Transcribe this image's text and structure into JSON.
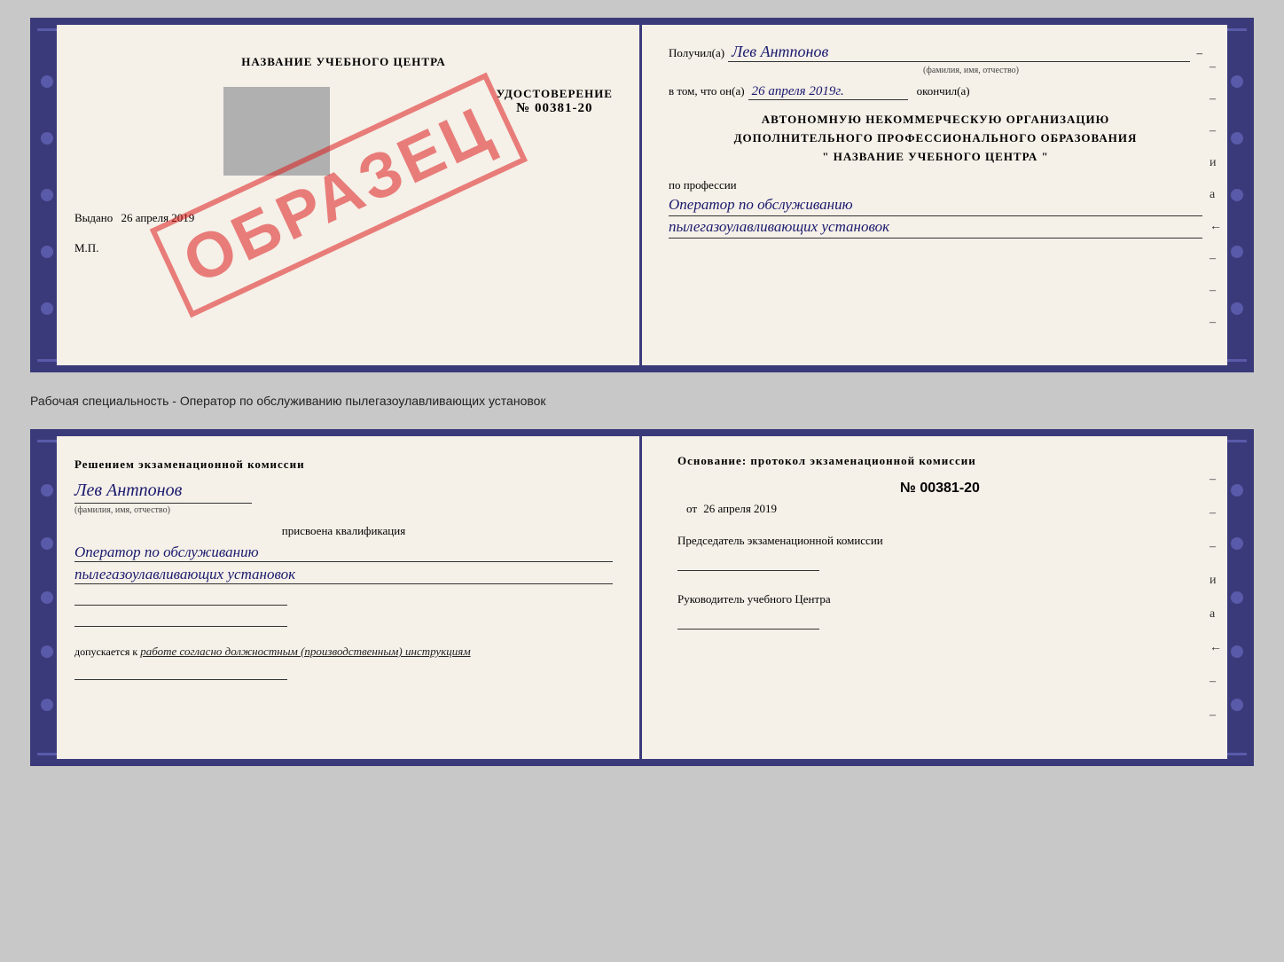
{
  "top_cert": {
    "left": {
      "title": "НАЗВАНИЕ УЧЕБНОГО ЦЕНТРА",
      "udost_label": "УДОСТОВЕРЕНИЕ",
      "udost_num": "№ 00381-20",
      "vydano_label": "Выдано",
      "vydano_date": "26 апреля 2019",
      "mp_label": "М.П.",
      "obrazec": "ОБРАЗЕЦ"
    },
    "right": {
      "poluchil_label": "Получил(a)",
      "poluchil_value": "Лев Антпонов",
      "fio_sub": "(фамилия, имя, отчество)",
      "vtom_label": "в том, что он(а)",
      "vtom_date": "26 апреля 2019г.",
      "okonchil_label": "окончил(а)",
      "org_line1": "АВТОНОМНУЮ НЕКОММЕРЧЕСКУЮ ОРГАНИЗАЦИЮ",
      "org_line2": "ДОПОЛНИТЕЛЬНОГО ПРОФЕССИОНАЛЬНОГО ОБРАЗОВАНИЯ",
      "org_line3": "\"   НАЗВАНИЕ УЧЕБНОГО ЦЕНТРА   \"",
      "profession_label": "по профессии",
      "profession_line1": "Оператор по обслуживанию",
      "profession_line2": "пылегазоулавливающих установок",
      "dashes": [
        "-",
        "-",
        "-",
        "и",
        "а",
        "←",
        "-",
        "-",
        "-"
      ]
    }
  },
  "separator": {
    "text": "Рабочая специальность - Оператор по обслуживанию пылегазоулавливающих установок"
  },
  "bottom_cert": {
    "left": {
      "komissia_label": "Решением экзаменационной комиссии",
      "name_value": "Лев Антпонов",
      "fio_sub": "(фамилия, имя, отчество)",
      "prisvoena_label": "присвоена квалификация",
      "qual_line1": "Оператор по обслуживанию",
      "qual_line2": "пылегазоулавливающих установок",
      "empty_line1": "",
      "empty_line2": "",
      "dopusk_label": "допускается к",
      "dopusk_value": "работе согласно должностным (производственным) инструкциям"
    },
    "right": {
      "osnov_label": "Основание: протокол экзаменационной комиссии",
      "protocol_num": "№ 00381-20",
      "ot_label": "от",
      "ot_date": "26 апреля 2019",
      "predsedatel_label": "Председатель экзаменационной комиссии",
      "rukov_label": "Руководитель учебного Центра",
      "dashes": [
        "-",
        "-",
        "-",
        "и",
        "а",
        "←",
        "-",
        "-"
      ]
    }
  }
}
